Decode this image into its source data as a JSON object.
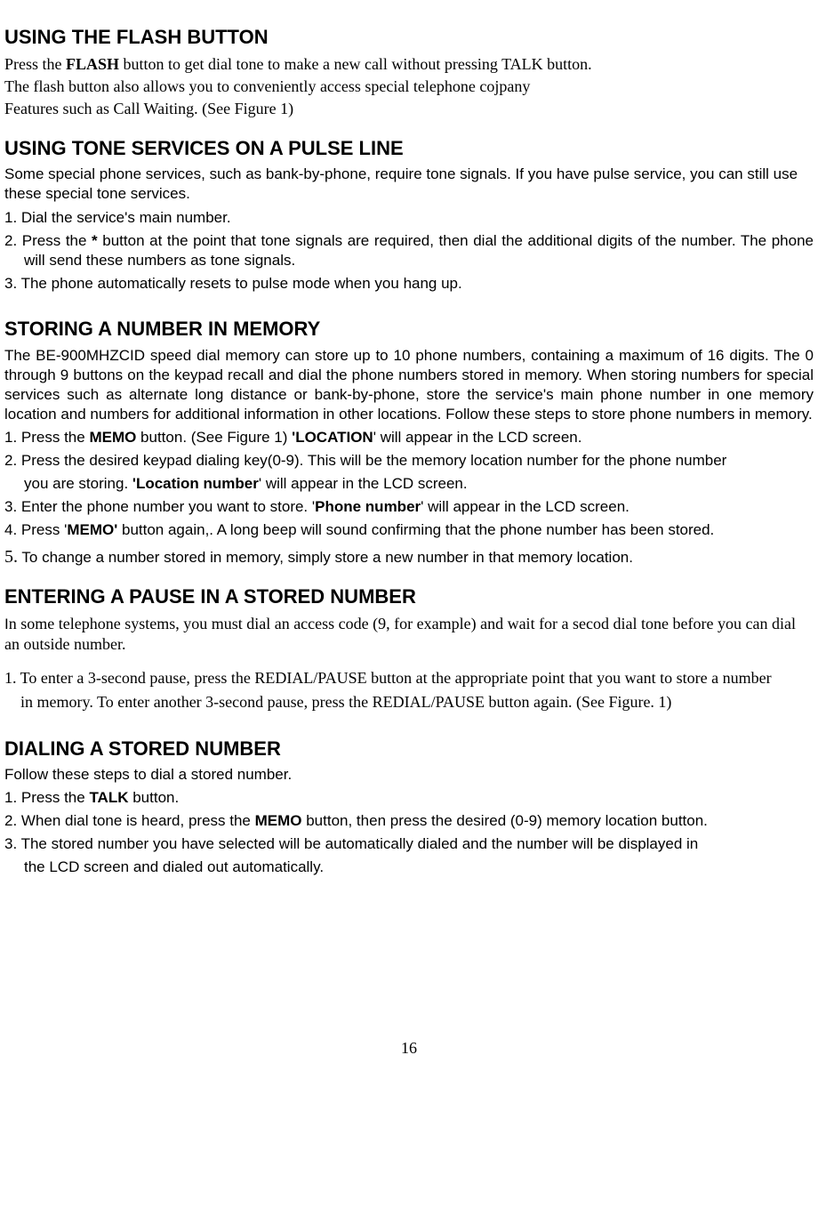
{
  "s1": {
    "title": "USING THE FLASH BUTTON",
    "p1a": "Press the ",
    "p1b": "FLASH",
    "p1c": " button to get dial tone to make a new call without pressing TALK button.",
    "p2": "The flash button also allows you to conveniently access special telephone cojpany",
    "p3": "Features such as Call Waiting.  (See Figure 1)"
  },
  "s2": {
    "title": "USING TONE SERVICES ON A PULSE LINE",
    "intro": "Some special phone services, such as bank-by-phone, require tone signals. If you have pulse service, you can still use these special tone services.",
    "li1": "1. Dial the service's main number.",
    "li2a": "2. Press the ",
    "li2b": "*",
    "li2c": " button at the point that tone signals are required, then dial the additional digits of the number. The phone will send these numbers as tone signals.",
    "li3": "3. The phone automatically resets to pulse mode when you hang up."
  },
  "s3": {
    "title": "STORING A NUMBER IN MEMORY",
    "intro": "The BE-900MHZCID speed dial memory can store up to 10 phone numbers, containing a maximum of 16 digits. The 0 through 9 buttons on the keypad recall and dial the phone numbers stored in memory. When storing numbers for special services such as alternate long distance or bank-by-phone, store the service's main phone number in one memory location and numbers for additional information in other locations. Follow these steps to store phone numbers in memory.",
    "li1a": "1. Press the ",
    "li1b": "MEMO",
    "li1c": " button. (See Figure 1)  ",
    "li1d": "'LOCATION",
    "li1e": "' will appear in the LCD screen.",
    "li2a": "2. Press the desired keypad dialing key(0-9). This will be the memory location number for the phone number",
    "li2sub_a": "you are storing. ",
    "li2sub_b": "'Location number",
    "li2sub_c": "' will appear in the LCD screen.",
    "li3a": "3. Enter the phone number you want to store. '",
    "li3b": "Phone number",
    "li3c": "' will appear in the LCD screen.",
    "li4a": "4. Press '",
    "li4b": "MEMO'",
    "li4c": " button again,. A long beep will sound confirming that the phone number has been stored.",
    "li5num": "5.",
    "li5": " To change a number stored in memory, simply store a new number in that memory location."
  },
  "s4": {
    "title": "ENTERING A PAUSE IN A STORED NUMBER",
    "p1a": "I",
    "p1b": "n some telephone systems, you must dial an access code (9, for example) and wait for a secod dial tone before you can dial an outside number.",
    "li1": "1. To enter a 3-second pause, press the REDIAL/PAUSE button at the appropriate point that you want to store a number",
    "li1sub": "in memory. To enter another 3-second pause, press the REDIAL/PAUSE button again. (See Figure. 1)"
  },
  "s5": {
    "title": "DIALING A STORED NUMBER",
    "intro": "Follow these steps to dial a stored number.",
    "li1a": "1. Press the ",
    "li1b": "TALK",
    "li1c": " button.",
    "li2a": "2. When dial tone is heard, press the ",
    "li2b": "MEMO",
    "li2c": " button, then press the desired (0-9) memory location button.",
    "li3": "3. The stored number you have selected will be automatically dialed and the number will be displayed in",
    "li3sub": "the LCD screen and dialed out automatically."
  },
  "pagenum": "16"
}
